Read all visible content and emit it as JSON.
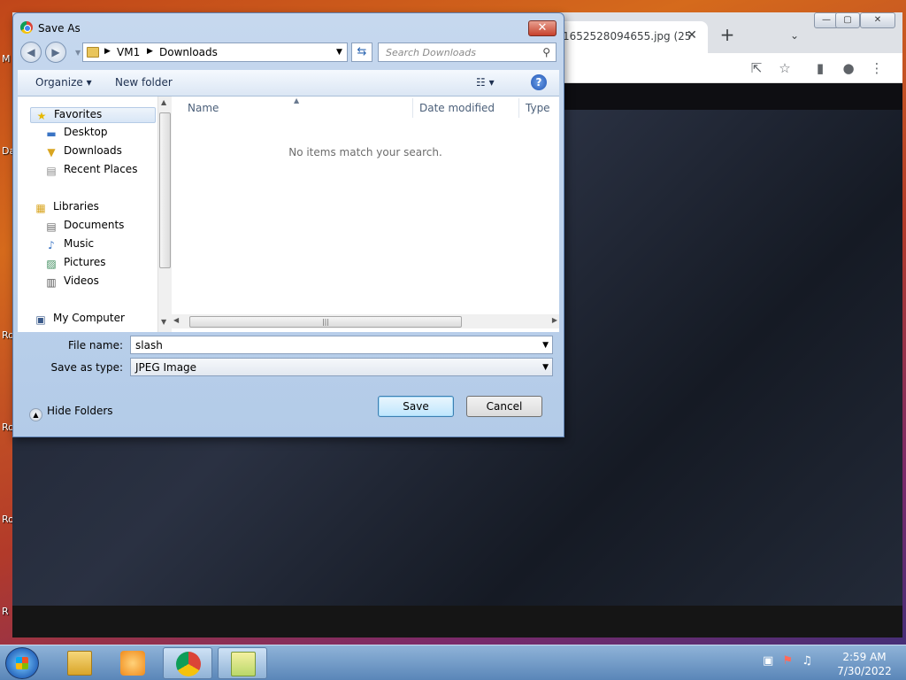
{
  "browser": {
    "tab_title": "1652528094655.jpg (25",
    "tab_close": "✕",
    "new_tab": "+",
    "tab_menu": "⌄",
    "win_min": "—",
    "win_max": "▢",
    "win_close": "✕"
  },
  "dialog": {
    "title": "Save As",
    "close": "✕",
    "address": {
      "segments": [
        "VM1",
        "Downloads"
      ]
    },
    "search_placeholder": "Search Downloads",
    "toolbar": {
      "organize": "Organize ▾",
      "new_folder": "New folder"
    },
    "nav": {
      "favorites": "Favorites",
      "items_favorites": [
        "Desktop",
        "Downloads",
        "Recent Places"
      ],
      "libraries": "Libraries",
      "items_libraries": [
        "Documents",
        "Music",
        "Pictures",
        "Videos"
      ],
      "computer": "My Computer"
    },
    "columns": [
      "Name",
      "Date modified",
      "Type"
    ],
    "empty_message": "No items match your search.",
    "file_name_label": "File name:",
    "file_name_value": "slash",
    "save_type_label": "Save as type:",
    "save_type_value": "JPEG Image",
    "hide_folders": "Hide Folders",
    "save_button": "Save",
    "cancel_button": "Cancel"
  },
  "desktop_fragments": [
    "M",
    "Da",
    "Ro",
    "Ro",
    "Ro",
    "R"
  ],
  "taskbar": {
    "time": "2:59 AM",
    "date": "7/30/2022"
  }
}
